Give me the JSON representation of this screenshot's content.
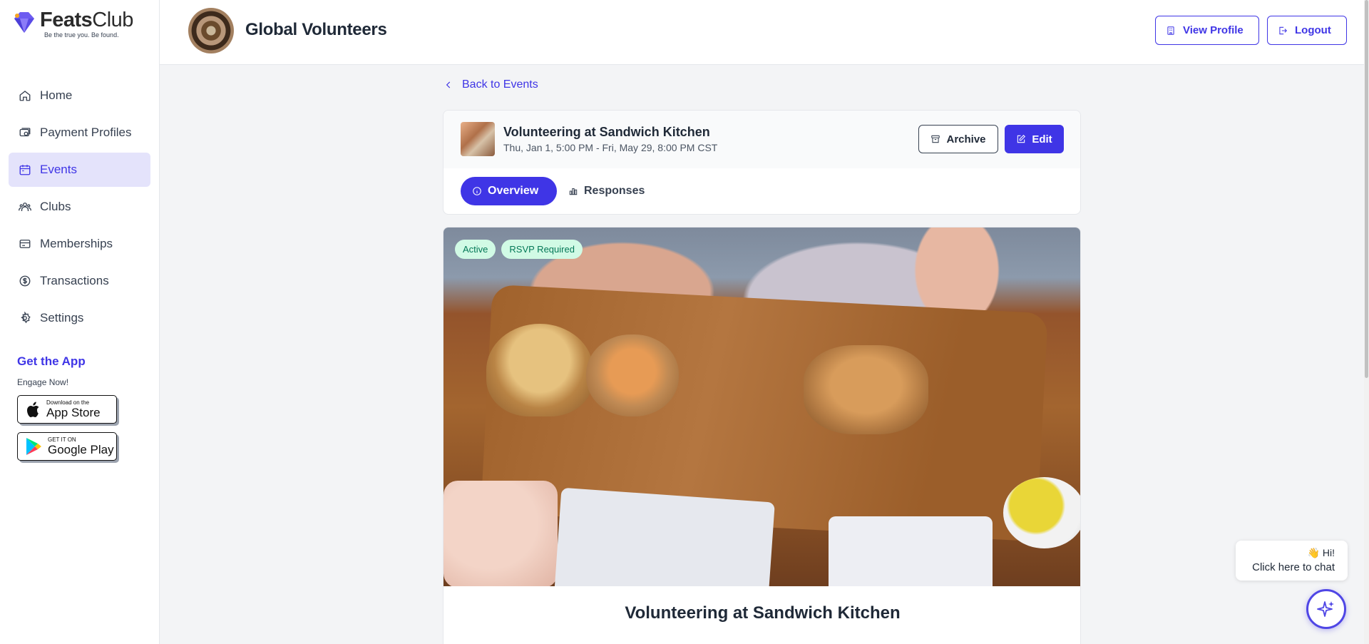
{
  "brand": {
    "name_bold": "Feats",
    "name_light": "Club",
    "tagline": "Be the true you. Be found.",
    "accent": "#3f35e6"
  },
  "sidebar": {
    "items": [
      {
        "label": "Home",
        "icon": "home-icon",
        "active": false
      },
      {
        "label": "Payment Profiles",
        "icon": "payment-profiles-icon",
        "active": false
      },
      {
        "label": "Events",
        "icon": "calendar-icon",
        "active": true
      },
      {
        "label": "Clubs",
        "icon": "users-icon",
        "active": false
      },
      {
        "label": "Memberships",
        "icon": "card-icon",
        "active": false
      },
      {
        "label": "Transactions",
        "icon": "dollar-icon",
        "active": false
      },
      {
        "label": "Settings",
        "icon": "gear-icon",
        "active": false
      }
    ],
    "get_app": {
      "title": "Get the App",
      "subtitle": "Engage Now!",
      "apple_small": "Download on the",
      "apple_big": "App Store",
      "google_small": "GET IT ON",
      "google_big": "Google Play"
    }
  },
  "header": {
    "club_name": "Global Volunteers",
    "view_profile_label": "View Profile",
    "logout_label": "Logout"
  },
  "main": {
    "back_label": "Back to Events",
    "event": {
      "title": "Volunteering at Sandwich Kitchen",
      "date_range": "Thu, Jan 1, 5:00 PM - Fri, May 29, 8:00 PM CST",
      "archive_label": "Archive",
      "edit_label": "Edit"
    },
    "tabs": [
      {
        "label": "Overview",
        "active": true
      },
      {
        "label": "Responses",
        "active": false
      }
    ],
    "badges": [
      "Active",
      "RSVP Required"
    ],
    "caption": "Volunteering at Sandwich Kitchen"
  },
  "chat": {
    "hi": "👋 Hi!",
    "cta": "Click here to chat"
  }
}
